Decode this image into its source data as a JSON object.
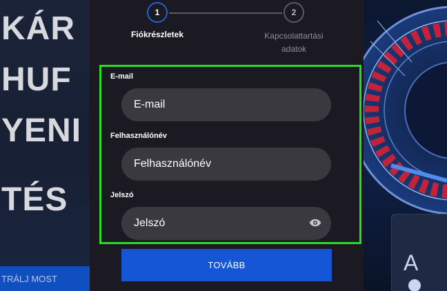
{
  "promo": {
    "lines": [
      "KÁR",
      "HUF",
      "YENI",
      "TÉS"
    ],
    "cta": "TRÁLJ MOST"
  },
  "stepper": {
    "steps": [
      {
        "number": "1",
        "label": "Fiókrészletek",
        "active": true
      },
      {
        "number": "2",
        "label_line1": "Kapcsolattartási",
        "label_line2": "adatok",
        "active": false
      }
    ]
  },
  "form": {
    "email": {
      "label": "E-mail",
      "placeholder": "E-mail"
    },
    "username": {
      "label": "Felhasználónév",
      "placeholder": "Felhasználónév"
    },
    "password": {
      "label": "Jelszó",
      "placeholder": "Jelszó"
    },
    "submit_label": "TOVÁBB"
  },
  "colors": {
    "accent": "#1556d6",
    "highlight": "#2bdc2b",
    "input_bg": "#3a3940",
    "panel_bg": "#1b1a22"
  },
  "icons": {
    "password_toggle": "eye-icon",
    "decor_right": "roulette-wheel-icon",
    "decor_card": "ace-card-icon"
  }
}
